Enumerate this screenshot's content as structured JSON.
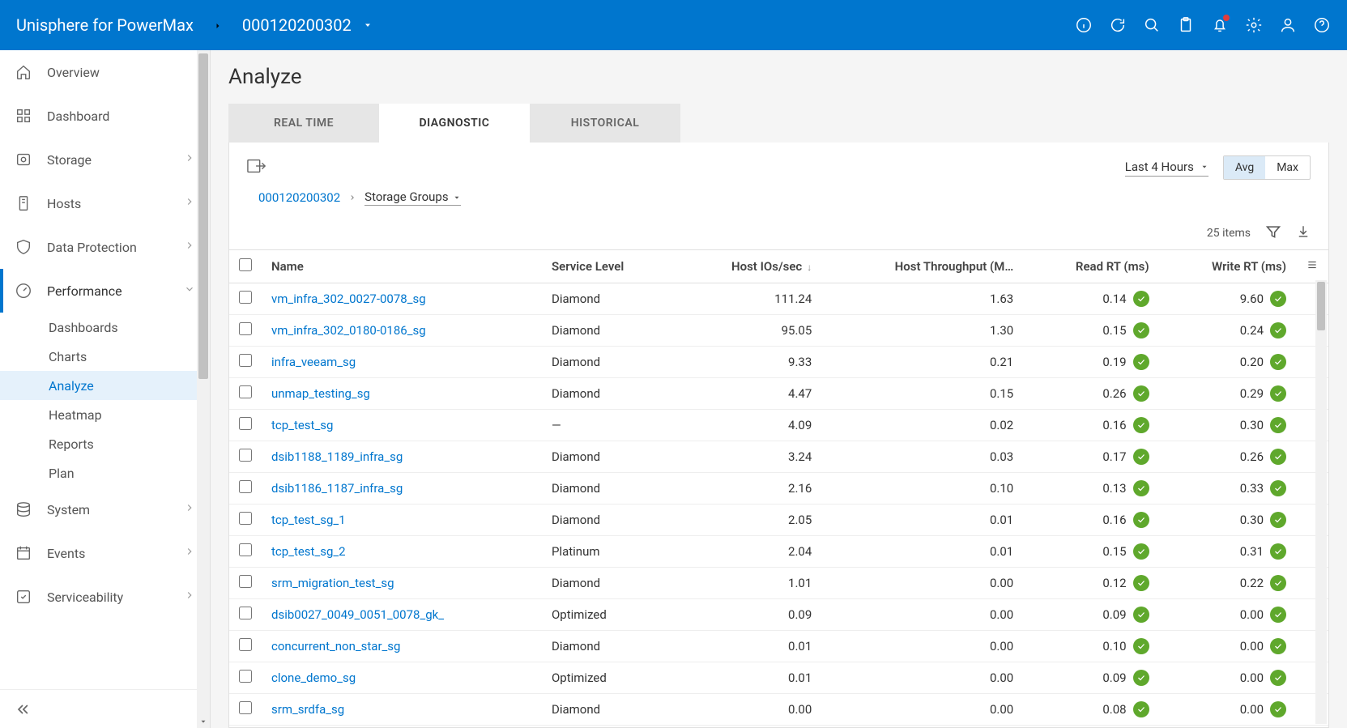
{
  "header": {
    "title": "Unisphere for PowerMax",
    "array_id": "000120200302"
  },
  "sidebar": {
    "items": [
      {
        "label": "Overview",
        "icon": "home",
        "expand": false
      },
      {
        "label": "Dashboard",
        "icon": "grid",
        "expand": false
      },
      {
        "label": "Storage",
        "icon": "disk",
        "expand": true
      },
      {
        "label": "Hosts",
        "icon": "host",
        "expand": true
      },
      {
        "label": "Data Protection",
        "icon": "shield",
        "expand": true
      },
      {
        "label": "Performance",
        "icon": "gauge",
        "expand": true,
        "open": true,
        "children": [
          {
            "label": "Dashboards"
          },
          {
            "label": "Charts"
          },
          {
            "label": "Analyze",
            "selected": true
          },
          {
            "label": "Heatmap"
          },
          {
            "label": "Reports"
          },
          {
            "label": "Plan"
          }
        ]
      },
      {
        "label": "System",
        "icon": "db",
        "expand": true
      },
      {
        "label": "Events",
        "icon": "calendar",
        "expand": true
      },
      {
        "label": "Serviceability",
        "icon": "service",
        "expand": true
      }
    ]
  },
  "main": {
    "page_title": "Analyze",
    "tabs": [
      "REAL TIME",
      "DIAGNOSTIC",
      "HISTORICAL"
    ],
    "active_tab": 1,
    "time_range": "Last 4 Hours",
    "agg": {
      "avg": "Avg",
      "max": "Max",
      "active": "avg"
    },
    "breadcrumb": {
      "root": "000120200302",
      "current": "Storage Groups"
    },
    "item_count": "25 items",
    "columns": [
      "Name",
      "Service Level",
      "Host IOs/sec",
      "Host Throughput (M…",
      "Read RT (ms)",
      "Write RT (ms)"
    ],
    "sort_col": 2,
    "rows": [
      {
        "name": "vm_infra_302_0027-0078_sg",
        "sl": "Diamond",
        "ios": "111.24",
        "thr": "1.63",
        "rrt": "0.14",
        "wrt": "9.60"
      },
      {
        "name": "vm_infra_302_0180-0186_sg",
        "sl": "Diamond",
        "ios": "95.05",
        "thr": "1.30",
        "rrt": "0.15",
        "wrt": "0.24"
      },
      {
        "name": "infra_veeam_sg",
        "sl": "Diamond",
        "ios": "9.33",
        "thr": "0.21",
        "rrt": "0.19",
        "wrt": "0.20"
      },
      {
        "name": "unmap_testing_sg",
        "sl": "Diamond",
        "ios": "4.47",
        "thr": "0.15",
        "rrt": "0.26",
        "wrt": "0.29"
      },
      {
        "name": "tcp_test_sg",
        "sl": "—",
        "ios": "4.09",
        "thr": "0.02",
        "rrt": "0.16",
        "wrt": "0.30"
      },
      {
        "name": "dsib1188_1189_infra_sg",
        "sl": "Diamond",
        "ios": "3.24",
        "thr": "0.03",
        "rrt": "0.17",
        "wrt": "0.26"
      },
      {
        "name": "dsib1186_1187_infra_sg",
        "sl": "Diamond",
        "ios": "2.16",
        "thr": "0.10",
        "rrt": "0.13",
        "wrt": "0.33"
      },
      {
        "name": "tcp_test_sg_1",
        "sl": "Diamond",
        "ios": "2.05",
        "thr": "0.01",
        "rrt": "0.16",
        "wrt": "0.30"
      },
      {
        "name": "tcp_test_sg_2",
        "sl": "Platinum",
        "ios": "2.04",
        "thr": "0.01",
        "rrt": "0.15",
        "wrt": "0.31"
      },
      {
        "name": "srm_migration_test_sg",
        "sl": "Diamond",
        "ios": "1.01",
        "thr": "0.00",
        "rrt": "0.12",
        "wrt": "0.22"
      },
      {
        "name": "dsib0027_0049_0051_0078_gk_",
        "sl": "Optimized",
        "ios": "0.09",
        "thr": "0.00",
        "rrt": "0.09",
        "wrt": "0.00"
      },
      {
        "name": "concurrent_non_star_sg",
        "sl": "Diamond",
        "ios": "0.01",
        "thr": "0.00",
        "rrt": "0.10",
        "wrt": "0.00"
      },
      {
        "name": "clone_demo_sg",
        "sl": "Optimized",
        "ios": "0.01",
        "thr": "0.00",
        "rrt": "0.09",
        "wrt": "0.00"
      },
      {
        "name": "srm_srdfa_sg",
        "sl": "Diamond",
        "ios": "0.00",
        "thr": "0.00",
        "rrt": "0.08",
        "wrt": "0.00"
      }
    ]
  }
}
